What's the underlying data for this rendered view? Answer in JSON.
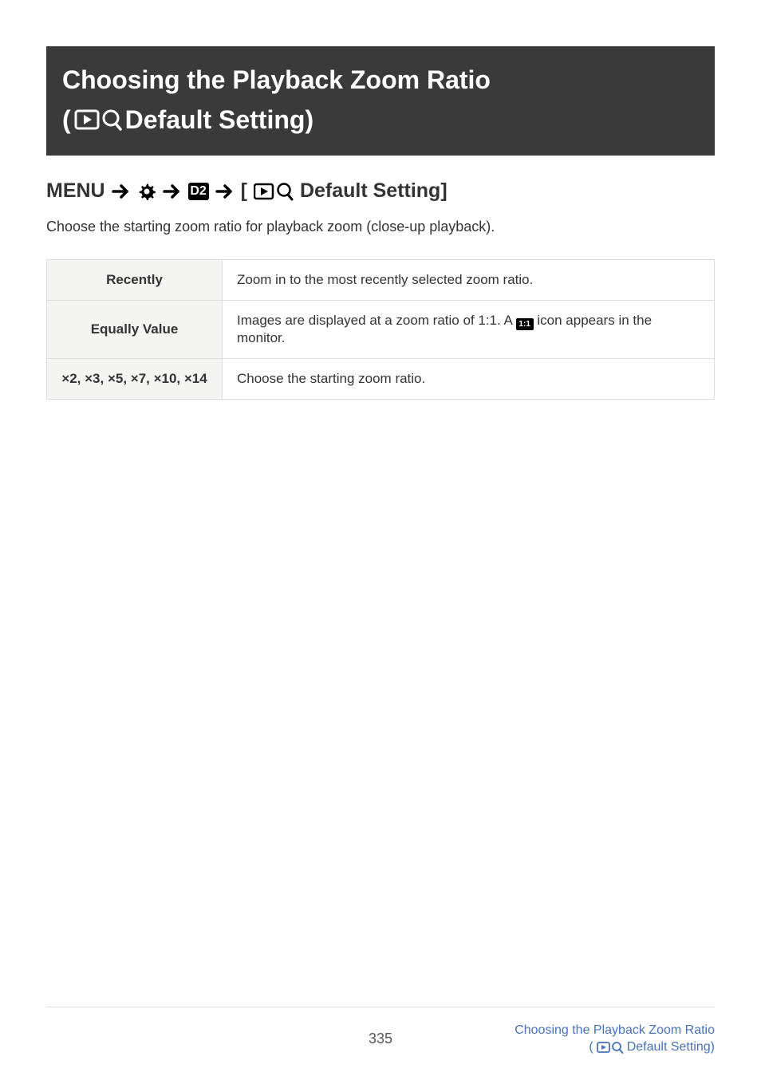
{
  "header": {
    "title_line1": "Choosing the Playback Zoom Ratio",
    "title_line2_prefix": "(",
    "title_line2_suffix": " Default Setting)"
  },
  "breadcrumb": {
    "label_menu": "MENU",
    "d2_label": "D2",
    "suffix_open": "[",
    "suffix_text": " Default Setting]"
  },
  "intro": "Choose the starting zoom ratio for playback zoom (close-up playback).",
  "table": {
    "rows": [
      {
        "label": "Recently",
        "desc": "Zoom in to the most recently selected zoom ratio."
      },
      {
        "label": "Equally Value",
        "desc_pre": "Images are displayed at a zoom ratio of 1:1. A ",
        "desc_icon": "1:1",
        "desc_post": " icon appears in the monitor."
      },
      {
        "label": "×2, ×3, ×5, ×7, ×10, ×14",
        "desc": "Choose the starting zoom ratio."
      }
    ]
  },
  "footer": {
    "page": "335",
    "link_line1": "Choosing the Playback Zoom Ratio",
    "link_line2_prefix": "(",
    "link_line2_suffix": " Default Setting)"
  }
}
